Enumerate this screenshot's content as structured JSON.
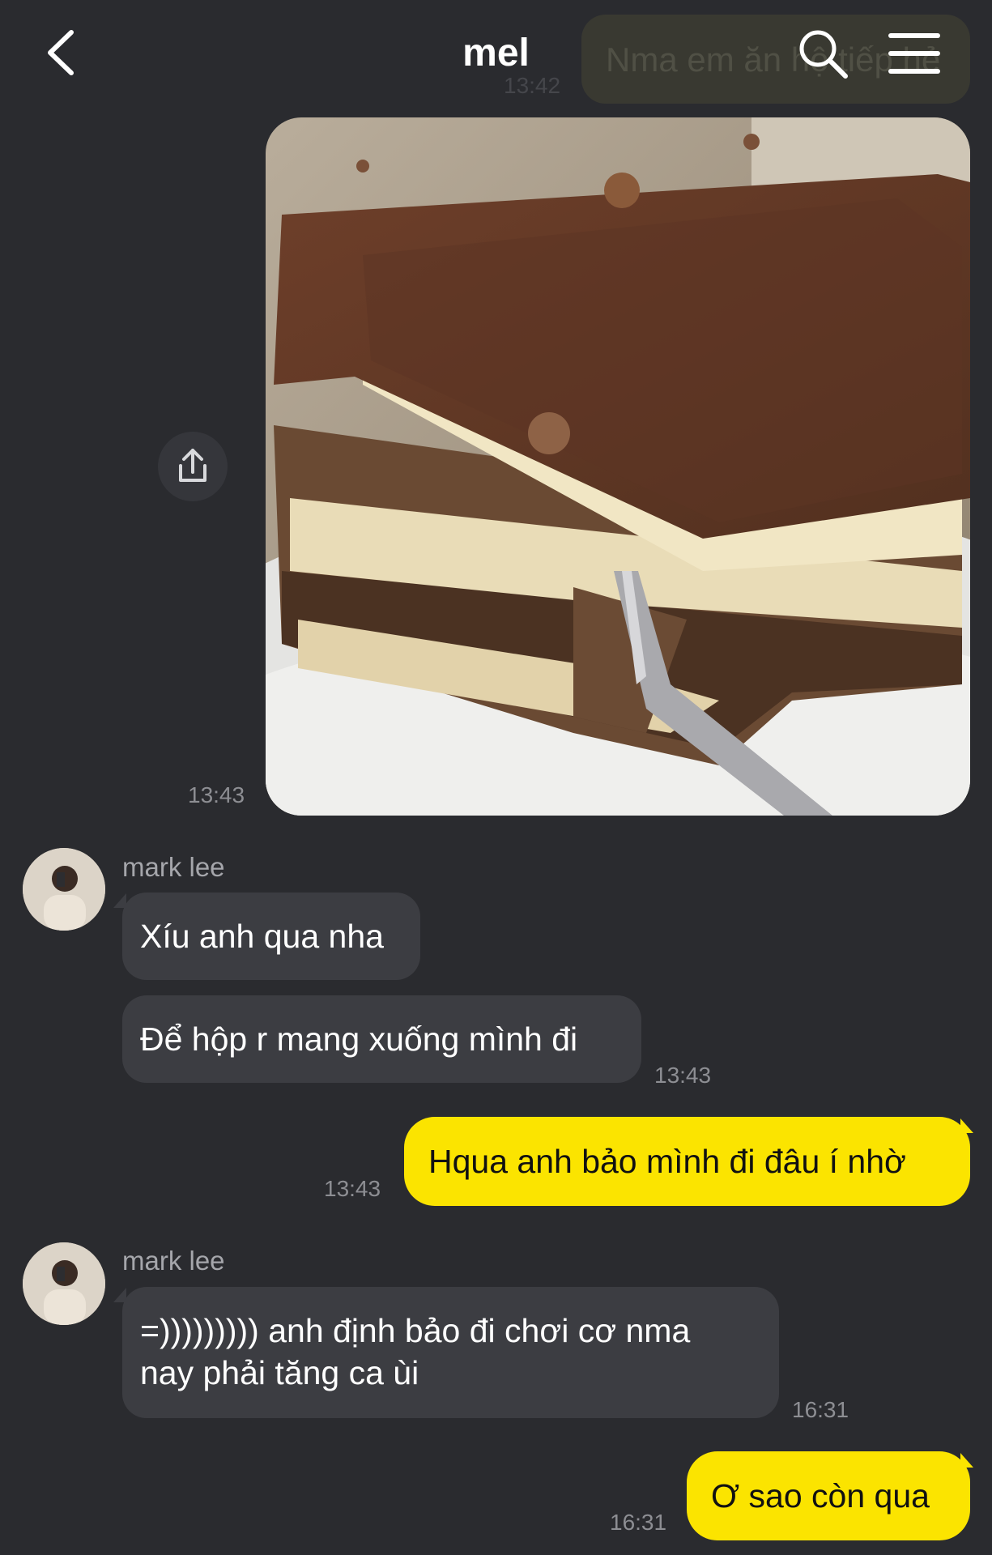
{
  "header": {
    "title": "mel",
    "ghost_message": "Nma em ăn hộ tiếp hẻ",
    "ghost_time": "13:42"
  },
  "messages": [
    {
      "id": "photo",
      "type": "photo",
      "direction": "out",
      "time": "13:43"
    },
    {
      "id": "m1",
      "direction": "in",
      "sender": "mark lee",
      "text": "Xíu anh qua nha"
    },
    {
      "id": "m2",
      "direction": "in",
      "text": "Để hộp r mang xuống mình đi",
      "time": "13:43"
    },
    {
      "id": "m3",
      "direction": "out",
      "text": "Hqua anh bảo mình đi đâu í nhờ",
      "time": "13:43"
    },
    {
      "id": "m4",
      "direction": "in",
      "sender": "mark lee",
      "text_line1": "=))))))))) anh định bảo đi chơi cơ nma",
      "text_line2": "nay phải tăng ca ùi",
      "time": "16:31"
    },
    {
      "id": "m5",
      "direction": "out",
      "text": "Ơ sao còn qua",
      "time": "16:31"
    }
  ],
  "colors": {
    "background": "#2a2b2f",
    "incoming_bubble": "#3c3d42",
    "outgoing_bubble": "#fbe400",
    "timestamp": "#8d8e93"
  },
  "icons": [
    "back-arrow-icon",
    "search-icon",
    "menu-icon",
    "share-icon",
    "avatar"
  ]
}
